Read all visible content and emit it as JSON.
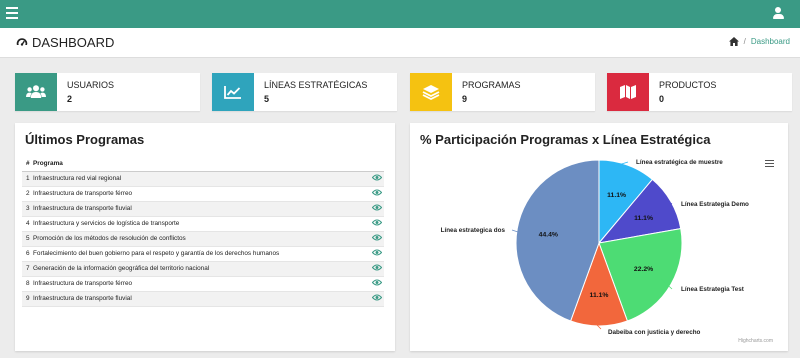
{
  "header": {
    "title": "DASHBOARD",
    "breadcrumb_current": "Dashboard"
  },
  "stats": [
    {
      "label": "USUARIOS",
      "value": "2",
      "color": "#3a9a85",
      "icon": "users-icon"
    },
    {
      "label": "LÍNEAS ESTRATÉGICAS",
      "value": "5",
      "color": "#2fa4bc",
      "icon": "line-chart-icon"
    },
    {
      "label": "PROGRAMAS",
      "value": "9",
      "color": "#f5c211",
      "icon": "layers-icon"
    },
    {
      "label": "PRODUCTOS",
      "value": "0",
      "color": "#da2a3f",
      "icon": "map-icon"
    }
  ],
  "programs_card": {
    "title": "Últimos Programas",
    "columns": [
      "#",
      "Programa"
    ],
    "rows": [
      {
        "num": "1",
        "name": "Infraestructura red vial regional"
      },
      {
        "num": "2",
        "name": "Infraestructura de transporte férreo"
      },
      {
        "num": "3",
        "name": "Infraestructura de transporte fluvial"
      },
      {
        "num": "4",
        "name": "Infraestructura y servicios de logística de transporte"
      },
      {
        "num": "5",
        "name": "Promoción de los métodos de resolución de conflictos"
      },
      {
        "num": "6",
        "name": "Fortalecimiento del buen gobierno para el respeto y garantía de los derechos humanos"
      },
      {
        "num": "7",
        "name": "Generación de la información geográfica del territorio nacional"
      },
      {
        "num": "8",
        "name": "Infraestructura de transporte férreo"
      },
      {
        "num": "9",
        "name": "Infraestructura de transporte fluvial"
      }
    ]
  },
  "chart_card": {
    "title": "% Participación Programas x Línea Estratégica",
    "credits": "Highcharts.com"
  },
  "chart_data": {
    "type": "pie",
    "title": "% Participación Programas x Línea Estratégica",
    "slices": [
      {
        "name": "Línea estratégica de muestre",
        "value": 11.1,
        "label": "11.1%",
        "color": "#2db7f5"
      },
      {
        "name": "Línea Estrategia Demo",
        "value": 11.1,
        "label": "11.1%",
        "color": "#4f4acb"
      },
      {
        "name": "Línea Estrategia Test",
        "value": 22.2,
        "label": "22.2%",
        "color": "#4ddc74"
      },
      {
        "name": "Dabeiba con justicia y derecho",
        "value": 11.1,
        "label": "11.1%",
        "color": "#f2673c"
      },
      {
        "name": "Línea estrategica dos",
        "value": 44.4,
        "label": "44.4%",
        "color": "#6c8ec2"
      }
    ]
  }
}
